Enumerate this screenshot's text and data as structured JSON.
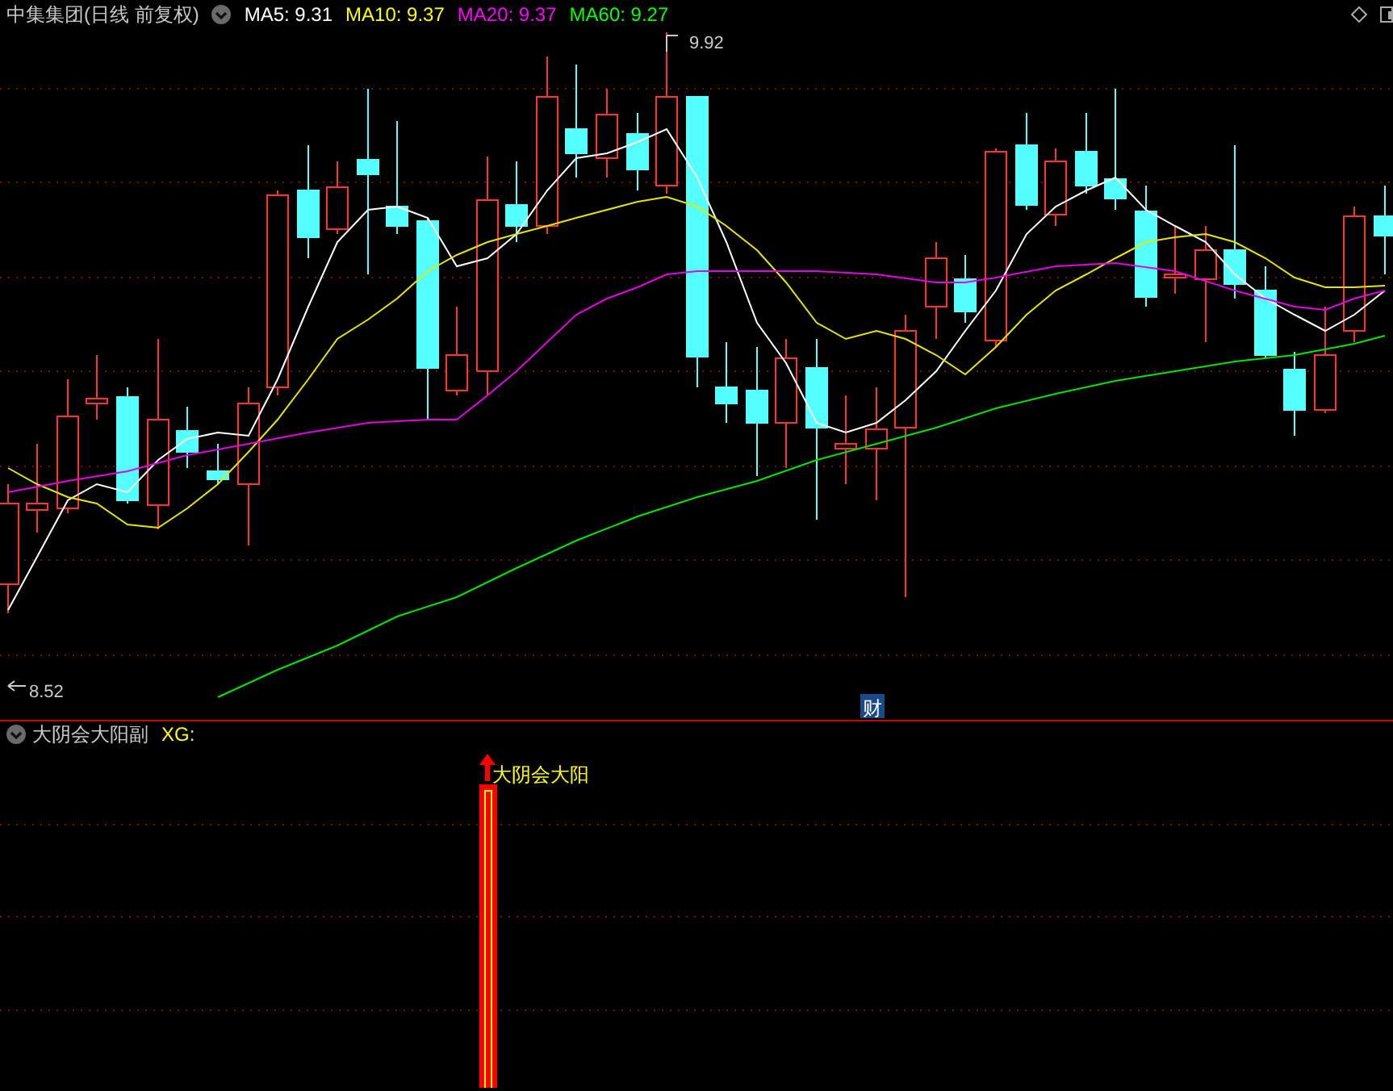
{
  "header": {
    "title": "中集集团(日线 前复权)",
    "indicators": [
      {
        "label": "MA5: 9.31",
        "color": "#ffffff"
      },
      {
        "label": "MA10: 9.37",
        "color": "#ffff00"
      },
      {
        "label": "MA20: 9.37",
        "color": "#ff00ff"
      },
      {
        "label": "MA60: 9.27",
        "color": "#00ff00"
      }
    ]
  },
  "main_chart": {
    "high_label": "9.92",
    "low_label": "8.52",
    "marker": "财"
  },
  "sub_panel": {
    "title": "大阴会大阳副",
    "output": "XG:",
    "signal_label": "大阴会大阳"
  }
}
